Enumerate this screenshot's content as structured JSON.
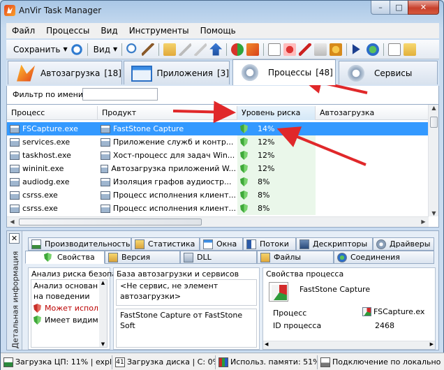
{
  "window": {
    "title": "AnVir Task Manager",
    "minimize": "–",
    "maximize": "□",
    "close": "✕"
  },
  "menu": [
    "Файл",
    "Процессы",
    "Вид",
    "Инструменты",
    "Помощь"
  ],
  "toolbar": {
    "save_label": "Сохранить",
    "view_label": "Вид"
  },
  "main_tabs": [
    {
      "label": "Автозагрузка",
      "count": "[18]"
    },
    {
      "label": "Приложения",
      "count": "[3]"
    },
    {
      "label": "Процессы",
      "count": "[48]"
    },
    {
      "label": "Сервисы",
      "count": ""
    }
  ],
  "filter": {
    "label": "Фильтр по имени:",
    "value": ""
  },
  "grid": {
    "columns": [
      "Процесс",
      "Продукт",
      "Уровень риска",
      "Автозагрузка"
    ],
    "rows": [
      {
        "process": "FSCapture.exe",
        "product": "FastStone Capture",
        "risk": "14%",
        "selected": true
      },
      {
        "process": "services.exe",
        "product": "Приложение служб и контр...",
        "risk": "12%",
        "selected": false
      },
      {
        "process": "taskhost.exe",
        "product": "Хост-процесс для задач Win...",
        "risk": "12%",
        "selected": false
      },
      {
        "process": "wininit.exe",
        "product": "Автозагрузка приложений W...",
        "risk": "12%",
        "selected": false
      },
      {
        "process": "audiodg.exe",
        "product": "Изоляция графов аудиостр...",
        "risk": "8%",
        "selected": false
      },
      {
        "process": "csrss.exe",
        "product": "Процесс исполнения клиент...",
        "risk": "8%",
        "selected": false
      },
      {
        "process": "csrss.exe",
        "product": "Процесс исполнения клиент...",
        "risk": "8%",
        "selected": false
      }
    ]
  },
  "detail": {
    "side_label": "Детальная информация",
    "close_glyph": "✕",
    "tabs_row1": [
      "Производительность",
      "Статистика",
      "Окна",
      "Потоки",
      "Дескрипторы",
      "Драйверы"
    ],
    "tabs_row2": [
      "Свойства",
      "Версия",
      "DLL",
      "Файлы",
      "Соединения"
    ],
    "pane1": {
      "header": "Анализ риска безопас",
      "text1": "Анализ основан",
      "text2": "на поведении",
      "item1": "Может испол",
      "item2": "Имеет видим"
    },
    "pane2": {
      "header": "База автозагрузки и сервисов",
      "text1": "<Не сервис, не элемент",
      "text2": "автозагрузки>",
      "text3": "FastStone Capture от FastStone",
      "text4": "Soft"
    },
    "pane3": {
      "header": "Свойства процесса",
      "name": "FastStone Capture",
      "label1": "Процесс",
      "value1": "FSCapture.ex",
      "label2": "ID процесса",
      "value2": "2468"
    }
  },
  "status": {
    "cpu": "Загрузка ЦП: 11% | expl",
    "disk_num": "41",
    "disk": "Загрузка диска | C: 0% /",
    "mem": "Использ. памяти: 51% |",
    "net": "Подключение по локально"
  },
  "colors": {
    "selection": "#3399ff",
    "risk_bg": "#eaf7ea",
    "annotation_arrow": "#e0282a"
  }
}
